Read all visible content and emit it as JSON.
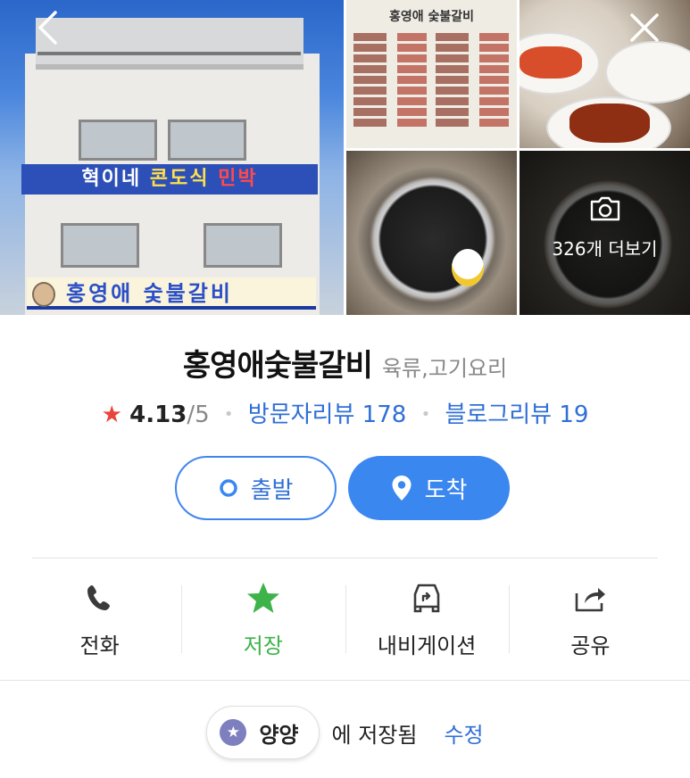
{
  "gallery": {
    "more_count_text": "326개 더보기",
    "main_sign_text_1a": "혁이네 ",
    "main_sign_text_1b": "콘도식",
    "main_sign_text_1c": " 민박",
    "main_sign_text_2": "홍영애 숯불갈비",
    "menu_board_title": "홍영애 숯불갈비",
    "icons": {
      "back": "chevron-left-icon",
      "close": "close-icon",
      "camera": "camera-icon"
    }
  },
  "place": {
    "name": "홍영애숯불갈비",
    "category": "육류,고기요리",
    "rating": "4.13",
    "rating_suffix": "/5",
    "visitor_reviews": "방문자리뷰 178",
    "blog_reviews": "블로그리뷰 19"
  },
  "route": {
    "depart_label": "출발",
    "arrive_label": "도착"
  },
  "actions": [
    {
      "label": "전화",
      "icon": "phone-icon"
    },
    {
      "label": "저장",
      "icon": "star-icon"
    },
    {
      "label": "내비게이션",
      "icon": "car-navigation-icon"
    },
    {
      "label": "공유",
      "icon": "share-icon"
    }
  ],
  "saved": {
    "list_name": "양양",
    "saved_text": "에 저장됨",
    "edit_label": "수정"
  },
  "colors": {
    "accent_blue": "#3a87f0",
    "link_blue": "#2f6fd6",
    "save_green": "#3db34a",
    "star_red": "#e8453c",
    "chip_purple": "#7d7fbf"
  }
}
